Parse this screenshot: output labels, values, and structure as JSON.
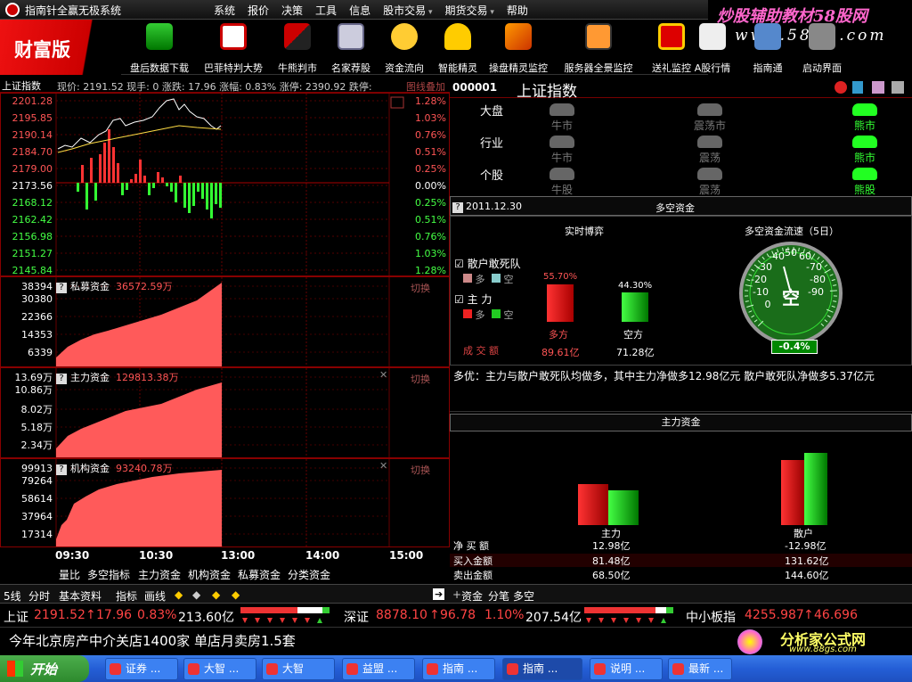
{
  "window": {
    "title": "指南针全赢无极系统"
  },
  "menu": [
    "系统",
    "报价",
    "决策",
    "工具",
    "信息",
    "股市交易",
    "期货交易",
    "帮助"
  ],
  "watermark": {
    "line1": "炒股辅助教材58股网",
    "line2": "www.58Gu.com"
  },
  "brand": "财富版",
  "toolbar": [
    "盘后数据下载",
    "巴菲特判大势",
    "牛熊判市",
    "名家荐股",
    "资金流向",
    "智能精灵",
    "操盘精灵监控",
    "服务器全景监控",
    "送礼监控",
    "A股行情",
    "指南通",
    "启动界面"
  ],
  "chart_header": {
    "index": "上证指数",
    "quote": "现价: 2191.52 现手: 0 涨跌: 17.96 涨幅: 0.83% 涨停: 2390.92 跌停:",
    "overlay": "图线叠加"
  },
  "price_panel": {
    "left_labels": [
      "2201.28",
      "2195.85",
      "2190.14",
      "2184.70",
      "2179.00",
      "2173.56",
      "2168.12",
      "2162.42",
      "2156.98",
      "2151.27",
      "2145.84"
    ],
    "right_labels": [
      "1.28%",
      "1.03%",
      "0.76%",
      "0.51%",
      "0.25%",
      "0.00%",
      "0.25%",
      "0.51%",
      "0.76%",
      "1.03%",
      "1.28%"
    ]
  },
  "panels": [
    {
      "title": "私募资金",
      "value": "36572.59万",
      "labels": [
        "38394",
        "30380",
        "22366",
        "14353",
        "6339"
      ],
      "switch": "切换"
    },
    {
      "title": "主力资金",
      "value": "129813.38万",
      "labels": [
        "13.69万",
        "10.86万",
        "8.02万",
        "5.18万",
        "2.34万"
      ],
      "switch": "切换"
    },
    {
      "title": "机构资金",
      "value": "93240.78万",
      "labels": [
        "99913",
        "79264",
        "58614",
        "37964",
        "17314"
      ],
      "switch": "切换"
    }
  ],
  "time_axis": [
    "09:30",
    "10:30",
    "13:00",
    "14:00",
    "15:00"
  ],
  "sub_tabs": [
    "量比",
    "多空指标",
    "主力资金",
    "机构资金",
    "私募资金",
    "分类资金"
  ],
  "right_header": {
    "code": "000001",
    "name": "上证指数"
  },
  "mood": {
    "rows": [
      "大盘",
      "行业",
      "个股"
    ],
    "states": [
      [
        "牛市",
        "震荡市",
        "熊市"
      ],
      [
        "牛市",
        "震荡",
        "熊市"
      ],
      [
        "牛股",
        "震荡",
        "熊股"
      ]
    ],
    "active": [
      2,
      2,
      2
    ]
  },
  "duokong": {
    "date": "2011.12.30",
    "title": "多空资金",
    "realtime": "实时博弈",
    "flow_title": "多空资金流速（5日）",
    "group1": "散户敢死队",
    "group2": "主    力",
    "long": "多",
    "short": "空",
    "long_pct": "55.70%",
    "short_pct": "44.30%",
    "long_label": "多方",
    "short_label": "空方",
    "volume_label": "成  交  额",
    "long_amt": "89.61亿",
    "short_amt": "71.28亿",
    "gauge_labels": [
      "-40",
      "50",
      "60",
      "-70",
      "-30",
      "-80",
      "-20",
      "-90",
      "-10",
      "空",
      "0"
    ],
    "gauge_value": "-0.4%",
    "long_share": 0.557,
    "short_share": 0.443
  },
  "description": "多优：主力与散户敢死队均做多，其中主力净做多12.98亿元 散户敢死队净做多5.37亿元",
  "zhuli": {
    "title": "主力资金",
    "group_labels": [
      "主力",
      "散户"
    ],
    "rows": [
      {
        "label": "净 买 额",
        "a": "12.98亿",
        "b": "-12.98亿"
      },
      {
        "label": "买入金额",
        "a": "81.48亿",
        "b": "131.62亿"
      },
      {
        "label": "卖出金额",
        "a": "68.50亿",
        "b": "144.60亿"
      }
    ]
  },
  "tabrow": [
    "5线",
    "分时",
    "基本资料",
    "指标",
    "画线",
    "资金",
    "分笔",
    "多空"
  ],
  "ticker": {
    "sh_label": "上证",
    "sh_val": "2191.52",
    "sh_chg": "17.96",
    "sh_pct": "0.83%",
    "sh_amt": "213.60亿",
    "sz_label": "深证",
    "sz_val": "8878.10",
    "sz_chg": "96.78",
    "sz_pct": "1.10%",
    "sz_amt": "207.54亿",
    "zx_label": "中小板指",
    "zx_val": "4255.987",
    "zx_chg": "46.696"
  },
  "news": "今年北京房产中介关店1400家 单店月卖房1.5套",
  "logo2": {
    "text": "分析家公式网",
    "url": "www.88gs.com"
  },
  "taskbar": {
    "start": "开始",
    "tasks": [
      "证券 ...",
      "大智 ...",
      "大智",
      "益盟 ...",
      "指南 ...",
      "指南 ...",
      "说明 ...",
      "最新 ..."
    ]
  },
  "colors": {
    "up": "#ff3333",
    "down": "#33ff33",
    "fund_fill": "#ff5a5a"
  }
}
